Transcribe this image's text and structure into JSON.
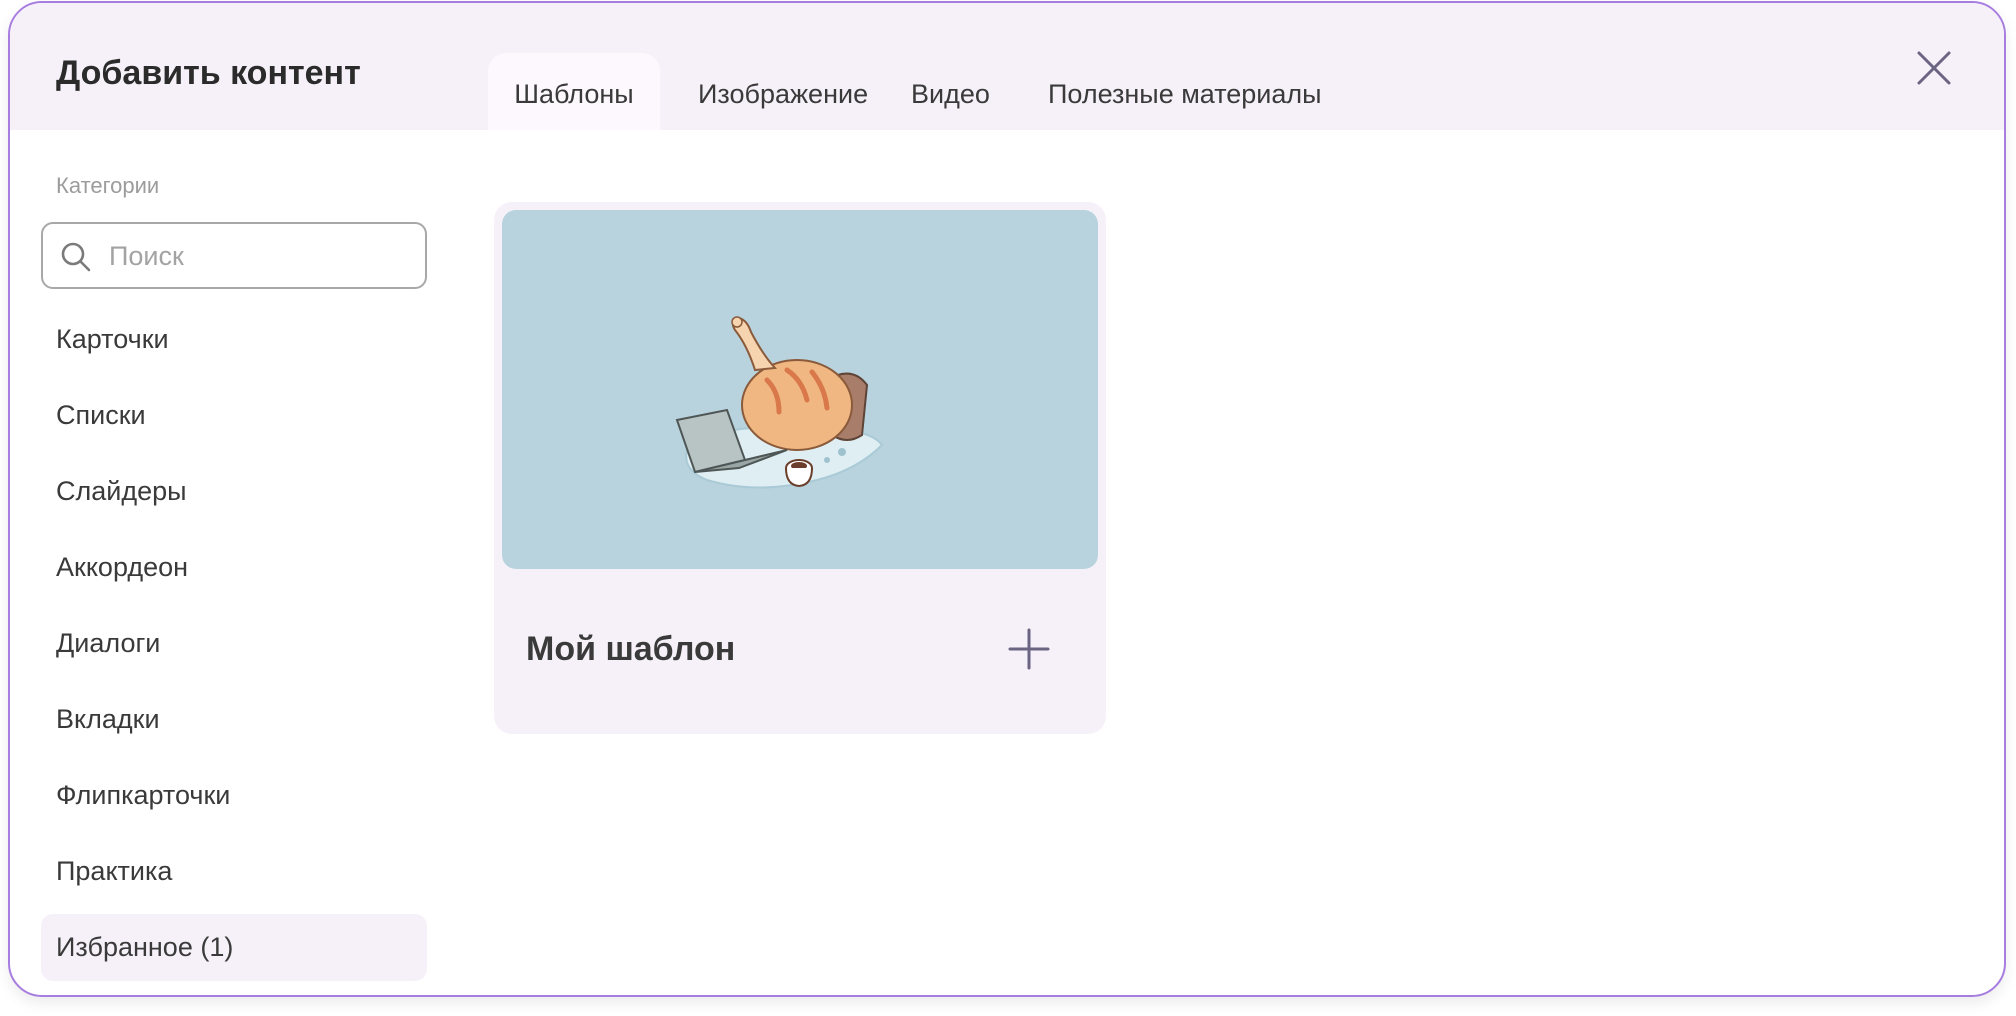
{
  "dialog": {
    "title": "Добавить контент"
  },
  "tabs": [
    {
      "label": "Шаблоны",
      "active": true
    },
    {
      "label": "Изображение",
      "active": false
    },
    {
      "label": "Видео",
      "active": false
    },
    {
      "label": "Полезные материалы",
      "active": false
    }
  ],
  "sidebar": {
    "categories_label": "Категории",
    "search": {
      "placeholder": "Поиск",
      "value": ""
    },
    "items": [
      {
        "label": "Карточки"
      },
      {
        "label": "Списки"
      },
      {
        "label": "Слайдеры"
      },
      {
        "label": "Аккордеон"
      },
      {
        "label": "Диалоги"
      },
      {
        "label": "Вкладки"
      },
      {
        "label": "Флипкарточки"
      },
      {
        "label": "Практика"
      },
      {
        "label": "Избранное (1)",
        "selected": true
      }
    ]
  },
  "templates": [
    {
      "title": "Мой шаблон",
      "preview": "cat-at-laptop-illustration"
    }
  ],
  "colors": {
    "accent_border": "#a77de0",
    "header_bg": "#f6f1f8",
    "preview_bg": "#b8d3dd",
    "icon": "#6b6483"
  }
}
